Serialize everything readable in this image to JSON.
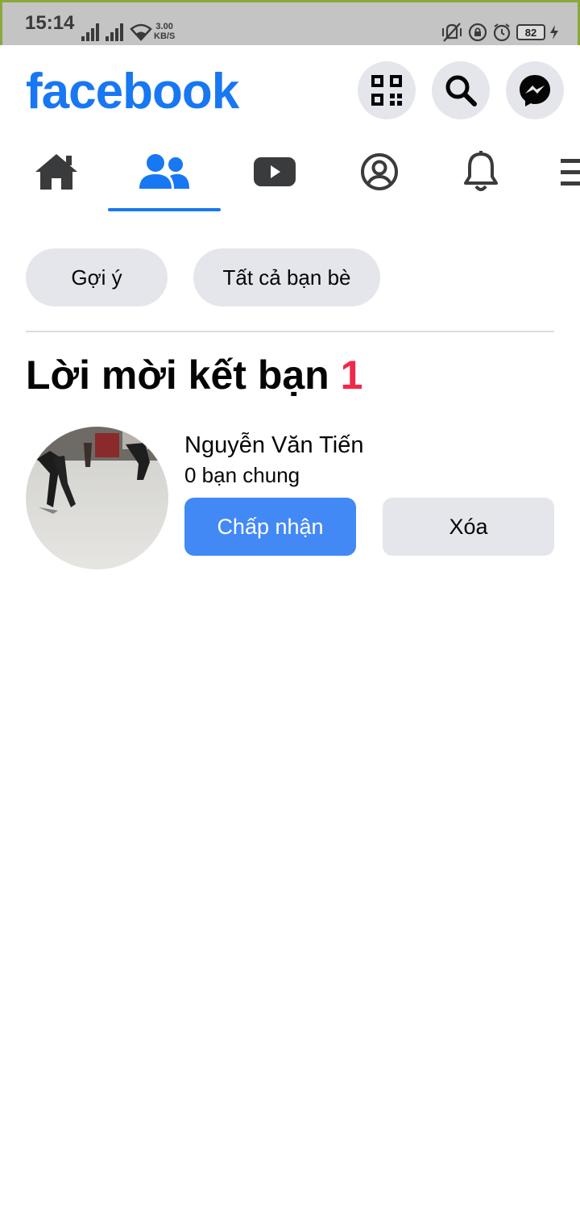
{
  "status_bar": {
    "time": "15:14",
    "net_speed_value": "3.00",
    "net_speed_unit": "KB/S",
    "battery": "82"
  },
  "header": {
    "logo": "facebook",
    "brand_color": "#1877f2",
    "icons": [
      "qr-code-icon",
      "search-icon",
      "messenger-icon"
    ]
  },
  "nav": {
    "tabs": [
      "home-icon",
      "friends-icon",
      "watch-icon",
      "profile-icon",
      "notifications-icon",
      "menu-icon"
    ],
    "active_tab": "friends-icon"
  },
  "chips": {
    "suggestions": "Gợi ý",
    "all_friends": "Tất cả bạn bè"
  },
  "requests": {
    "title": "Lời mời kết bạn",
    "count": "1",
    "count_color": "#f02849",
    "items": [
      {
        "name": "Nguyễn Văn Tiến",
        "mutual": "0 bạn chung",
        "accept_label": "Chấp nhận",
        "delete_label": "Xóa"
      }
    ]
  }
}
